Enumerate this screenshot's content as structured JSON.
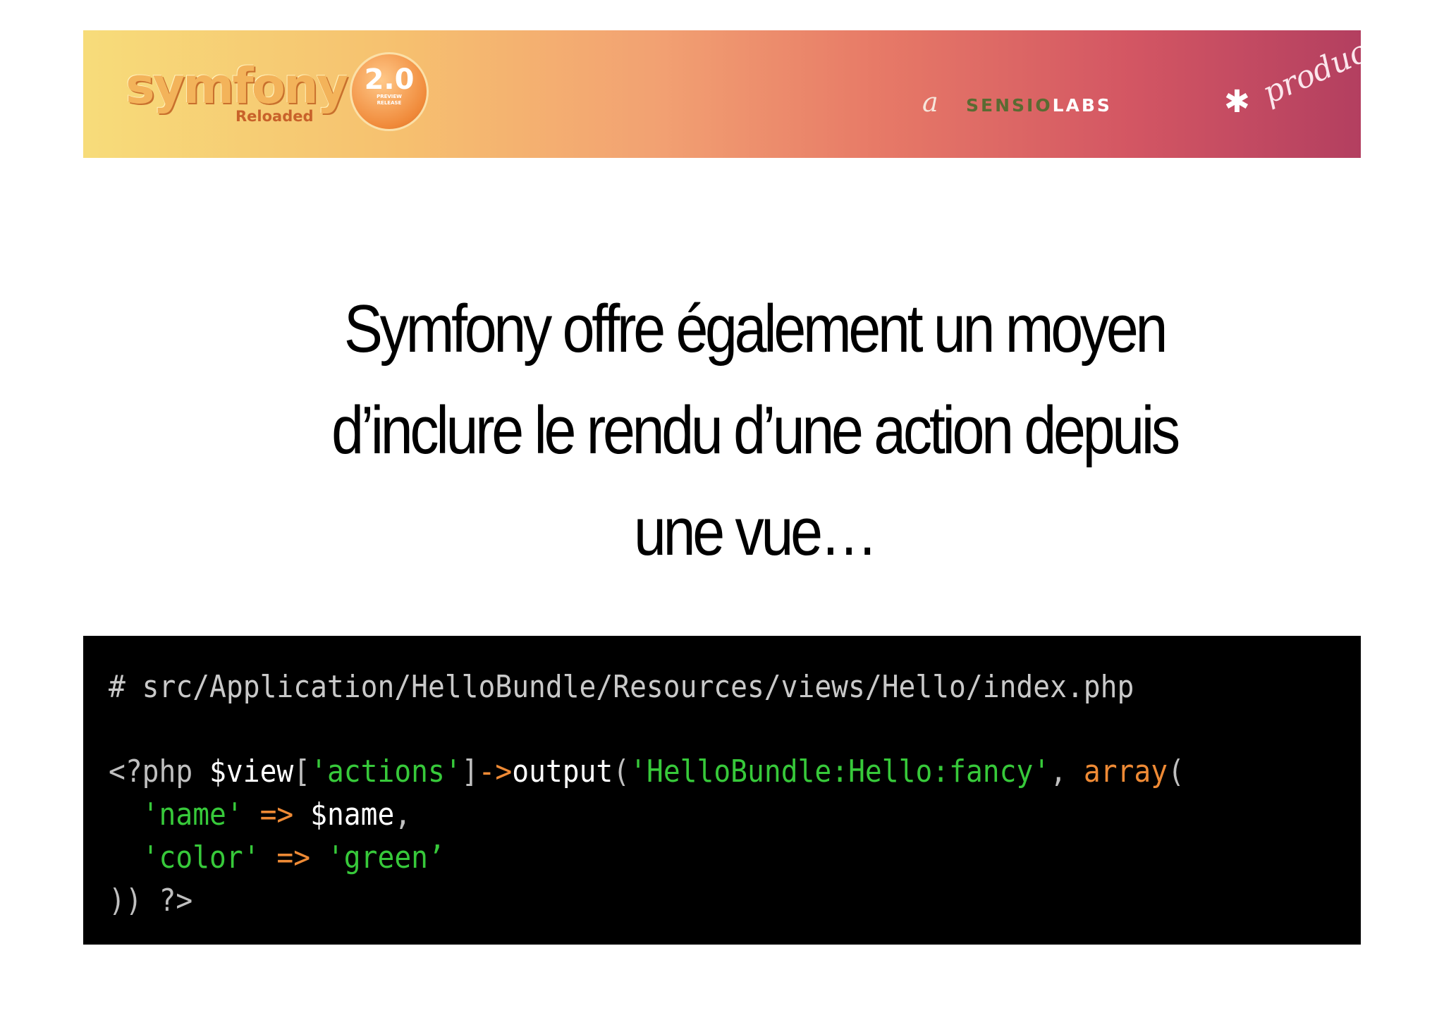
{
  "banner": {
    "logo_text": "symfony",
    "logo_subtitle": "Reloaded",
    "badge_version": "2.0",
    "badge_line1": "PREVIEW",
    "badge_line2": "RELEASE",
    "brand_a": "a",
    "brand_sensio": "SENSIO",
    "brand_labs": "LABS",
    "brand_product": "product",
    "colors": {
      "gradient_start": "#f7dc7a",
      "gradient_end": "#b33f60"
    }
  },
  "slide": {
    "title_lines": [
      "Symfony offre également un moyen",
      "d’inclure le rendu d’une action depuis",
      "une vue…"
    ]
  },
  "code": {
    "comment": "# src/Application/HelloBundle/Resources/views/Hello/index.php",
    "line1": {
      "open": "<?php ",
      "var": "$view",
      "bracket_open": "[",
      "key": "'actions'",
      "bracket_close": "]",
      "arrow": "->",
      "method": "output",
      "paren_open": "(",
      "template": "'HelloBundle:Hello:fancy'",
      "comma": ", ",
      "array_fn": "array",
      "array_open": "("
    },
    "line2": {
      "indent": "  ",
      "key": "'name'",
      "op": " => ",
      "value": "$name",
      "comma": ","
    },
    "line3": {
      "indent": "  ",
      "key": "'color'",
      "op": " => ",
      "value": "'green’"
    },
    "line4": {
      "close": ")) ",
      "tag_close": "?>"
    },
    "colors": {
      "background": "#000000",
      "string": "#37c93a",
      "operator": "#ee8a35",
      "text": "#ffffff"
    }
  }
}
